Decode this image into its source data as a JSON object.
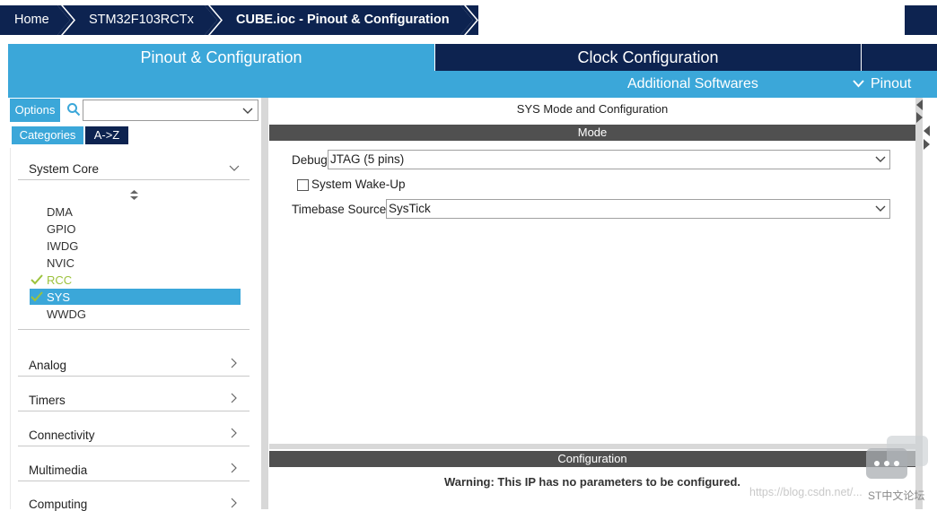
{
  "breadcrumb": {
    "items": [
      "Home",
      "STM32F103RCTx",
      "CUBE.ioc - Pinout & Configuration"
    ]
  },
  "tabs": {
    "pinout": "Pinout & Configuration",
    "clock": "Clock Configuration",
    "additional": "Additional Softwares",
    "pinout_menu": "Pinout"
  },
  "sidebar": {
    "options_label": "Options",
    "search_value": "",
    "categories_label": "Categories",
    "az_label": "A->Z",
    "system_core_label": "System Core",
    "items": [
      {
        "label": "DMA",
        "status": "none"
      },
      {
        "label": "GPIO",
        "status": "none"
      },
      {
        "label": "IWDG",
        "status": "none"
      },
      {
        "label": "NVIC",
        "status": "none"
      },
      {
        "label": "RCC",
        "status": "configured"
      },
      {
        "label": "SYS",
        "status": "selected"
      },
      {
        "label": "WWDG",
        "status": "none"
      }
    ],
    "categories": [
      "Analog",
      "Timers",
      "Connectivity",
      "Multimedia",
      "Computing"
    ]
  },
  "main": {
    "title": "SYS Mode and Configuration",
    "mode_header": "Mode",
    "debug_label": "Debug",
    "debug_value": "JTAG (5 pins)",
    "wakeup_label": "System Wake-Up",
    "wakeup_checked": false,
    "timebase_label": "Timebase Source",
    "timebase_value": "SysTick",
    "config_header": "Configuration",
    "warning": "Warning: This IP has no parameters to be configured."
  },
  "watermark": {
    "url": "https://blog.csdn.net/...",
    "brand": "ST中文论坛"
  },
  "colors": {
    "navy": "#0d2350",
    "accent": "#3ba7d9",
    "check_green": "#9cc23c",
    "bar_gray": "#505050"
  }
}
